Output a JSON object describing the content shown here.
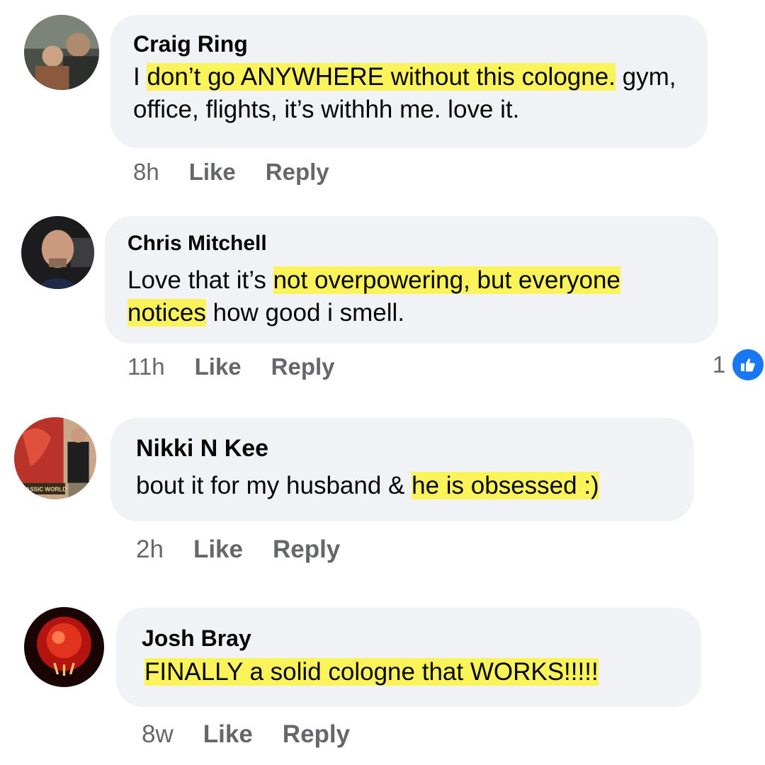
{
  "comments": [
    {
      "author": "Craig Ring",
      "text_before": "I ",
      "highlight": "don’t go ANYWHERE without this cologne.",
      "text_after": " gym, office, flights, it’s withhh me. love it.",
      "time": "8h",
      "like_label": "Like",
      "reply_label": "Reply"
    },
    {
      "author": "Chris Mitchell",
      "text_before": "Love that it’s ",
      "highlight": "not overpowering, but everyone notices",
      "text_after": " how good i smell.",
      "time": "11h",
      "like_label": "Like",
      "reply_label": "Reply",
      "reaction_count": "1",
      "reaction_icon": "thumbs-up-icon"
    },
    {
      "author": "Nikki N Kee",
      "text_before": "bout it for my husband & ",
      "highlight": "he is obsessed :)",
      "text_after": "",
      "time": "2h",
      "like_label": "Like",
      "reply_label": "Reply"
    },
    {
      "author": "Josh Bray",
      "text_before": "",
      "highlight": "FINALLY a solid cologne that WORKS!!!!!",
      "text_after": "",
      "time": "8w",
      "like_label": "Like",
      "reply_label": "Reply"
    }
  ],
  "colors": {
    "bubble": "#f0f2f5",
    "highlight": "#fbf35a",
    "meta_text": "#65676b",
    "like_blue": "#1877f2"
  }
}
